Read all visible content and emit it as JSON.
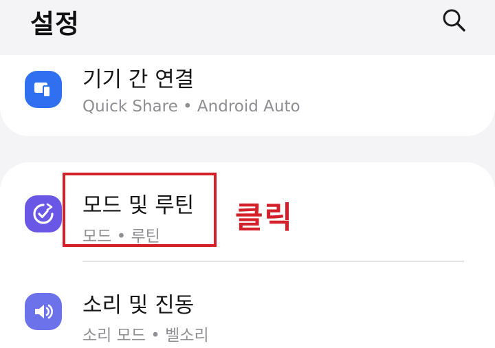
{
  "header": {
    "title": "설정"
  },
  "icons": {
    "search": "search-icon",
    "devices": "connected-devices-icon",
    "modes": "modes-routines-icon",
    "sound": "speaker-icon"
  },
  "colors": {
    "background": "#f4f4f6",
    "card": "#ffffff",
    "devices_icon": "#2f6ff0",
    "modes_icon": "#6b57e6",
    "sound_icon": "#6c72e9",
    "highlight": "#d3202a"
  },
  "items": [
    {
      "title": "기기 간 연결",
      "subtitle": "Quick Share  •  Android Auto"
    },
    {
      "title": "모드 및 루틴",
      "subtitle": "모드  •  루틴"
    },
    {
      "title": "소리 및 진동",
      "subtitle": "소리 모드  •  벨소리"
    }
  ],
  "annotation": {
    "text": "클릭"
  }
}
